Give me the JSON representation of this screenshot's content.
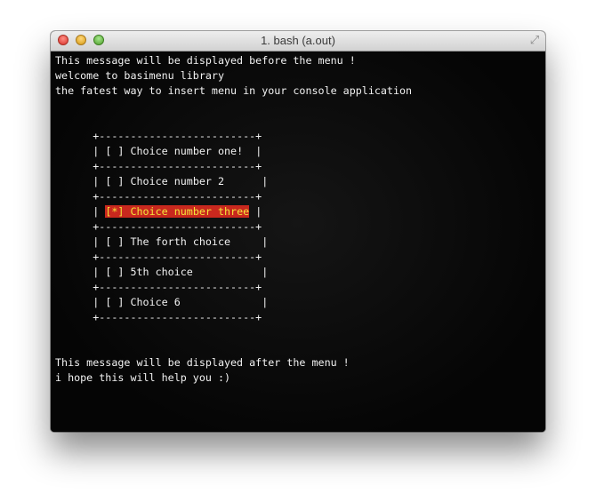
{
  "window": {
    "title": "1. bash (a.out)"
  },
  "terminal": {
    "header_lines": [
      "This message will be displayed before the menu !",
      "welcome to basimenu library",
      "the fatest way to insert menu in your console application"
    ],
    "menu": {
      "border": "+-------------------------+",
      "items": [
        {
          "prefix": "| ",
          "label": "[ ] Choice number one! ",
          "suffix": " |",
          "selected": false
        },
        {
          "prefix": "| ",
          "label": "[ ] Choice number 2     ",
          "suffix": " |",
          "selected": false
        },
        {
          "prefix": "| ",
          "label": "[*] Choice number three",
          "suffix": " |",
          "selected": true
        },
        {
          "prefix": "| ",
          "label": "[ ] The forth choice    ",
          "suffix": " |",
          "selected": false
        },
        {
          "prefix": "| ",
          "label": "[ ] 5th choice          ",
          "suffix": " |",
          "selected": false
        },
        {
          "prefix": "| ",
          "label": "[ ] Choice 6            ",
          "suffix": " |",
          "selected": false
        }
      ]
    },
    "footer_lines": [
      "This message will be displayed after the menu !",
      "i hope this will help you :)"
    ],
    "colors": {
      "background": "#0a0a0a",
      "text": "#f2f2f2",
      "selection_bg": "#c8281e",
      "selection_text": "#f4e43a"
    }
  }
}
